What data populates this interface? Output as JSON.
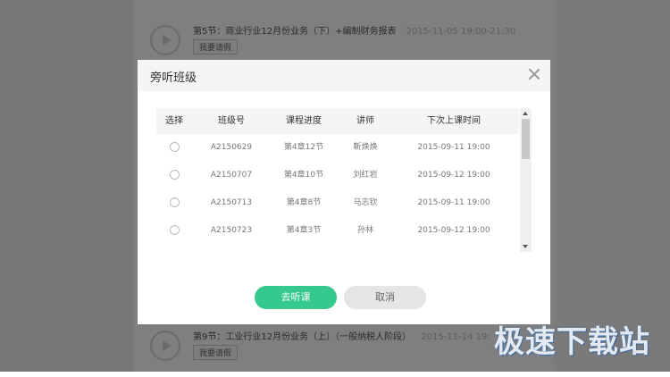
{
  "background": {
    "lessons": [
      {
        "title": "第5节：商业行业12月份业务（下）+编制财务报表",
        "time": "2015-11-05 19:00-21:30",
        "button": "我要请假"
      },
      {
        "title": "第9节：工业行业12月份业务（上）（一般纳税人阶段）",
        "time": "2015-11-14 19:",
        "button": "我要请假"
      }
    ]
  },
  "dialog": {
    "title": "旁听班级",
    "columns": [
      "选择",
      "班级号",
      "课程进度",
      "讲师",
      "下次上课时间"
    ],
    "rows": [
      {
        "class_no": "A2150629",
        "progress": "第4章12节",
        "teacher": "靳焕焕",
        "next_time": "2015-09-11 19:00"
      },
      {
        "class_no": "A2150707",
        "progress": "第4章10节",
        "teacher": "刘红岩",
        "next_time": "2015-09-12 19:00"
      },
      {
        "class_no": "A2150713",
        "progress": "第4章8节",
        "teacher": "马志钦",
        "next_time": "2015-09-11 19:00"
      },
      {
        "class_no": "A2150723",
        "progress": "第4章3节",
        "teacher": "孙林",
        "next_time": "2015-09-12 19:00"
      }
    ],
    "confirm_label": "去听课",
    "cancel_label": "取消"
  },
  "watermark": "极速下载站",
  "colors": {
    "primary": "#35c98e",
    "overlay": "rgba(0,0,0,0.5)"
  }
}
